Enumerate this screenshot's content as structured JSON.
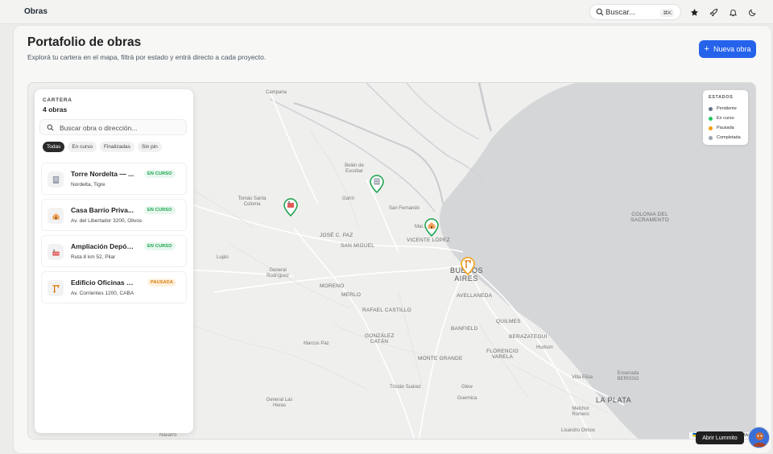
{
  "topbar": {
    "title": "Obras",
    "search_label": "Buscar...",
    "search_shortcut": "⌘K",
    "icons": [
      "star-icon",
      "rocket-icon",
      "bell-icon",
      "moon-icon"
    ]
  },
  "header": {
    "title": "Portafolio de obras",
    "subtitle": "Explorá tu cartera en el mapa, filtrá por estado y entrá directo a cada proyecto.",
    "new_button": "Nueva obra"
  },
  "panel": {
    "caption": "CARTERA",
    "count": "4 obras",
    "search_placeholder": "Buscar obra o dirección...",
    "filters": [
      {
        "label": "Todas",
        "active": true
      },
      {
        "label": "En curso",
        "active": false
      },
      {
        "label": "Finalizadas",
        "active": false
      },
      {
        "label": "Sin pin",
        "active": false
      }
    ],
    "items": [
      {
        "name": "Torre Nordelta — ...",
        "address": "Nordelta, Tigre",
        "status": "EN CURSO",
        "status_color": "green",
        "icon": "building-icon"
      },
      {
        "name": "Casa Barrio Priva...",
        "address": "Av. del Libertador 3200, Olivos",
        "status": "EN CURSO",
        "status_color": "green",
        "icon": "house-icon"
      },
      {
        "name": "Ampliación Depós...",
        "address": "Ruta 8 km 52, Pilar",
        "status": "EN CURSO",
        "status_color": "green",
        "icon": "factory-icon"
      },
      {
        "name": "Edificio Oficinas C...",
        "address": "Av. Corrientes 1200, CABA",
        "status": "PAUSADA",
        "status_color": "orange",
        "icon": "crane-icon"
      }
    ]
  },
  "legend": {
    "title": "ESTADOS",
    "items": [
      {
        "label": "Pendiente",
        "color": "#64748b"
      },
      {
        "label": "En curso",
        "color": "#22c55e"
      },
      {
        "label": "Pausada",
        "color": "#f59e0b"
      },
      {
        "label": "Completada",
        "color": "#9ca3af"
      }
    ]
  },
  "map": {
    "labels": {
      "campana": "Campana",
      "belen": "Belén de Escobar",
      "tomas": "Tomás Santa Coloma",
      "garin": "Garín",
      "sanfernando": "San Fernando",
      "jcpaz": "JOSÉ C. PAZ",
      "sanmiguel": "SAN MIGUEL",
      "vlopez": "VICENTE LÓPEZ",
      "martinez": "Mar...",
      "lujan": "Luján",
      "genrod": "General Rodríguez",
      "moreno": "MORENO",
      "merlo": "MERLO",
      "bsas": "BUENOS AIRES",
      "avellaneda": "AVELLANEDA",
      "rafael": "RAFAEL CASTILLO",
      "quilmes": "QUILMES",
      "banfield": "BANFIELD",
      "berazategui": "BERAZATEGUI",
      "gcatan": "GONZÁLEZ CATÁN",
      "marcospaz": "Marcos Paz",
      "hudson": "Hudson",
      "fvarela": "FLORENCIO VARELA",
      "mgrande": "MONTE GRANDE",
      "ensenada": "Ensenada BERISSO",
      "villaelisa": "Villa Elisa",
      "tristan": "Tristán Suárez",
      "glew": "Glew",
      "guernica": "Guernica",
      "laplata": "LA PLATA",
      "genlasheras": "General Las Heras",
      "melchor": "Melchor Romero",
      "lisandro": "Lisandro Olmos",
      "navarro": "Navarro",
      "sacramento": "COLONIA DEL SACRAMENTO"
    },
    "attribution": "🇺🇦 Leaflet | © OpenStreetMap"
  },
  "footer": {
    "open_button": "Abrir Lummito"
  }
}
